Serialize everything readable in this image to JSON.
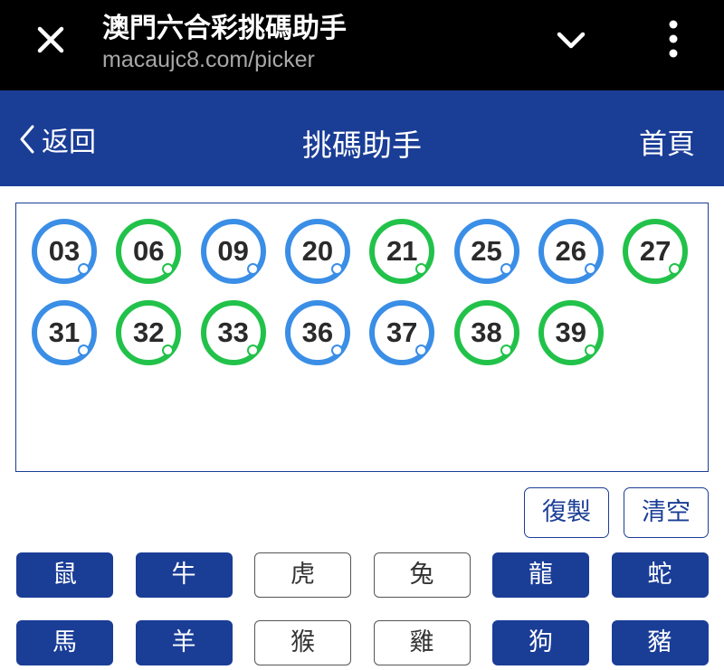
{
  "browser": {
    "title": "澳門六合彩挑碼助手",
    "url": "macaujc8.com/picker"
  },
  "header": {
    "back_label": "返回",
    "title": "挑碼助手",
    "home_label": "首頁"
  },
  "colors": {
    "header_bg": "#1a3d96",
    "ball_blue": "#3a8ee6",
    "ball_green": "#22c24a"
  },
  "balls": [
    {
      "num": "03",
      "color": "blue"
    },
    {
      "num": "06",
      "color": "green"
    },
    {
      "num": "09",
      "color": "blue"
    },
    {
      "num": "20",
      "color": "blue"
    },
    {
      "num": "21",
      "color": "green"
    },
    {
      "num": "25",
      "color": "blue"
    },
    {
      "num": "26",
      "color": "blue"
    },
    {
      "num": "27",
      "color": "green"
    },
    {
      "num": "31",
      "color": "blue"
    },
    {
      "num": "32",
      "color": "green"
    },
    {
      "num": "33",
      "color": "green"
    },
    {
      "num": "36",
      "color": "blue"
    },
    {
      "num": "37",
      "color": "blue"
    },
    {
      "num": "38",
      "color": "green"
    },
    {
      "num": "39",
      "color": "green"
    }
  ],
  "actions": {
    "copy_label": "復製",
    "clear_label": "清空"
  },
  "zodiacs": [
    {
      "label": "鼠",
      "selected": true
    },
    {
      "label": "牛",
      "selected": true
    },
    {
      "label": "虎",
      "selected": false
    },
    {
      "label": "兔",
      "selected": false
    },
    {
      "label": "龍",
      "selected": true
    },
    {
      "label": "蛇",
      "selected": true
    },
    {
      "label": "馬",
      "selected": true
    },
    {
      "label": "羊",
      "selected": true
    },
    {
      "label": "猴",
      "selected": false
    },
    {
      "label": "雞",
      "selected": false
    },
    {
      "label": "狗",
      "selected": true
    },
    {
      "label": "豬",
      "selected": true
    }
  ]
}
